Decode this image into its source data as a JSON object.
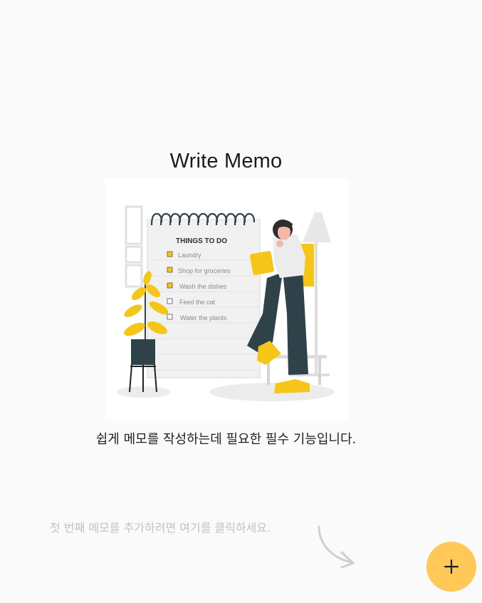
{
  "header": {
    "title": "Write Memo"
  },
  "illustration": {
    "heading": "THINGS TO DO",
    "items": [
      {
        "label": "Laundry",
        "checked": true
      },
      {
        "label": "Shop for groceries",
        "checked": true
      },
      {
        "label": "Wash the dishes",
        "checked": true
      },
      {
        "label": "Feed the cat",
        "checked": false
      },
      {
        "label": "Water the plants",
        "checked": false
      }
    ]
  },
  "main": {
    "subtitle": "쉽게 메모를 작성하는데 필요한 필수 기능입니다."
  },
  "empty_state": {
    "hint": "첫 번째 메모를 추가하려면 여기를 클릭하세요.",
    "arrow_icon": "curved-arrow-icon"
  },
  "fab": {
    "icon": "plus-icon",
    "color": "#ffc857"
  },
  "colors": {
    "background": "#fafafa",
    "accent_yellow": "#f5c518",
    "dark_teal": "#2d4249"
  }
}
